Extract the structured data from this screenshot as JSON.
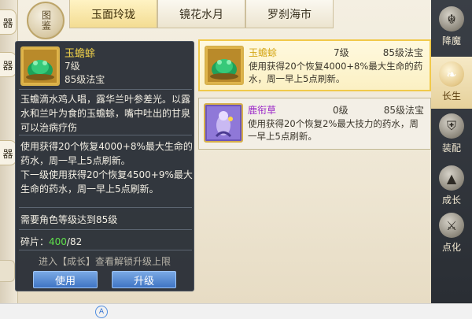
{
  "top_tabs": [
    {
      "label": "玉面玲珑",
      "active": true
    },
    {
      "label": "镜花水月",
      "active": false
    },
    {
      "label": "罗刹海市",
      "active": false
    }
  ],
  "tujian_label": "图鉴",
  "left_tabs": [
    "器",
    "器",
    "器"
  ],
  "sidebar": {
    "items": [
      {
        "label": "降魔",
        "icon": "demon-mask-icon",
        "active": false
      },
      {
        "label": "长生",
        "icon": "flame-icon",
        "active": true
      },
      {
        "label": "装配",
        "icon": "armor-icon",
        "active": false
      },
      {
        "label": "成长",
        "icon": "arrow-up-icon",
        "active": false
      },
      {
        "label": "点化",
        "icon": "swords-icon",
        "active": false
      }
    ]
  },
  "items": [
    {
      "name": "玉蟾蜍",
      "name_color": "#d4a514",
      "level": "7级",
      "grade": "85级法宝",
      "desc": "使用获得20个恢复4000+8%最大生命的药水，周一早上5点刷新。",
      "icon": "jade-toad-icon",
      "selected": true
    },
    {
      "name": "鹿衔草",
      "name_color": "#9b27c8",
      "level": "0级",
      "grade": "85级法宝",
      "desc": "使用获得20个恢复2%最大技力的药水，周一早上5点刷新。",
      "icon": "deer-herb-icon",
      "selected": false
    }
  ],
  "detail": {
    "name": "玉蟾蜍",
    "level": "7级",
    "grade": "85级法宝",
    "lore": "玉蟾滴水鸡人唱，露华兰叶参差光。以露水和兰叶为食的玉蟾蜍，嘴中吐出的甘泉可以治病疗伤",
    "effect_current": "使用获得20个恢复4000+8%最大生命的药水，周一早上5点刷新。",
    "effect_next": "下一级使用获得20个恢复4500+9%最大生命的药水，周一早上5点刷新。",
    "requirement": "需要角色等级达到85级",
    "fragment_label": "碎片：",
    "fragment_have": "400",
    "fragment_need": "/82",
    "hint": "进入【成长】查看解锁升级上限",
    "use_button": "使用",
    "upgrade_button": "升级"
  },
  "colors": {
    "accent_gold": "#f1c94a",
    "button_blue": "#3f74c4",
    "fragment_green": "#5ee04a",
    "tooltip_bg": "#262c34"
  }
}
